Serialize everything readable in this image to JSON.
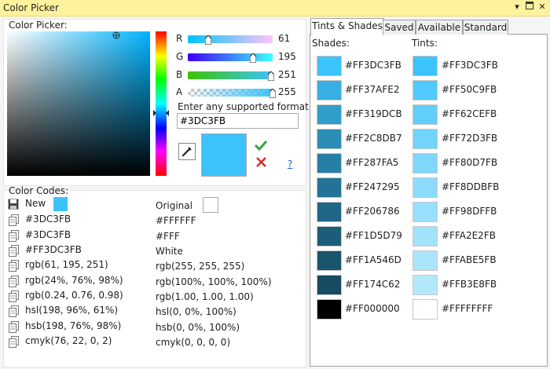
{
  "window": {
    "title": "Color Picker"
  },
  "picker": {
    "label": "Color Picker:",
    "channels": [
      {
        "name": "R",
        "value": "61",
        "level": 0.239
      },
      {
        "name": "G",
        "value": "195",
        "level": 0.765
      },
      {
        "name": "B",
        "value": "251",
        "level": 0.984
      },
      {
        "name": "A",
        "value": "255",
        "level": 1.0
      }
    ],
    "format_label": "Enter any supported format",
    "format_value": "#3DC3FB",
    "help_link": "?",
    "current_color": "#3DC3FB"
  },
  "codes": {
    "label": "Color Codes:",
    "new_label": "New",
    "original_label": "Original",
    "new_color": "#3DC3FB",
    "original_color": "#FFFFFF",
    "new_values": [
      "#3DC3FB",
      "#3DC3FB",
      "#FF3DC3FB",
      "rgb(61, 195, 251)",
      "rgb(24%, 76%, 98%)",
      "rgb(0.24, 0.76, 0.98)",
      "hsl(198, 96%, 61%)",
      "hsb(198, 76%, 98%)",
      "cmyk(76, 22, 0, 2)"
    ],
    "original_values": [
      "#FFFFFF",
      "#FFF",
      "White",
      "rgb(255, 255, 255)",
      "rgb(100%, 100%, 100%)",
      "rgb(1.00, 1.00, 1.00)",
      "hsl(0, 0%, 100%)",
      "hsb(0, 0%, 100%)",
      "cmyk(0, 0, 0, 0)"
    ]
  },
  "tabs": [
    "Tints & Shades",
    "Saved",
    "Available",
    "Standard"
  ],
  "shades_label": "Shades:",
  "tints_label": "Tints:",
  "shades": [
    {
      "label": "#FF3DC3FB",
      "color": "#3DC3FB"
    },
    {
      "label": "#FF37AFE2",
      "color": "#37AFE2"
    },
    {
      "label": "#FF319DCB",
      "color": "#319DCB"
    },
    {
      "label": "#FF2C8DB7",
      "color": "#2C8DB7"
    },
    {
      "label": "#FF287FA5",
      "color": "#287FA5"
    },
    {
      "label": "#FF247295",
      "color": "#247295"
    },
    {
      "label": "#FF206786",
      "color": "#206786"
    },
    {
      "label": "#FF1D5D79",
      "color": "#1D5D79"
    },
    {
      "label": "#FF1A546D",
      "color": "#1A546D"
    },
    {
      "label": "#FF174C62",
      "color": "#174C62"
    },
    {
      "label": "#FF000000",
      "color": "#000000"
    }
  ],
  "tints": [
    {
      "label": "#FF3DC3FB",
      "color": "#3DC3FB"
    },
    {
      "label": "#FF50C9FB",
      "color": "#50C9FB"
    },
    {
      "label": "#FF62CEFB",
      "color": "#62CEFB"
    },
    {
      "label": "#FF72D3FB",
      "color": "#72D3FB"
    },
    {
      "label": "#FF80D7FB",
      "color": "#80D7FB"
    },
    {
      "label": "#FF8DDBFB",
      "color": "#8DDBFB"
    },
    {
      "label": "#FF98DFFB",
      "color": "#98DFFB"
    },
    {
      "label": "#FFA2E2FB",
      "color": "#A2E2FB"
    },
    {
      "label": "#FFABE5FB",
      "color": "#ABE5FB"
    },
    {
      "label": "#FFB3E8FB",
      "color": "#B3E8FB"
    },
    {
      "label": "#FFFFFFFF",
      "color": "#FFFFFF"
    }
  ]
}
